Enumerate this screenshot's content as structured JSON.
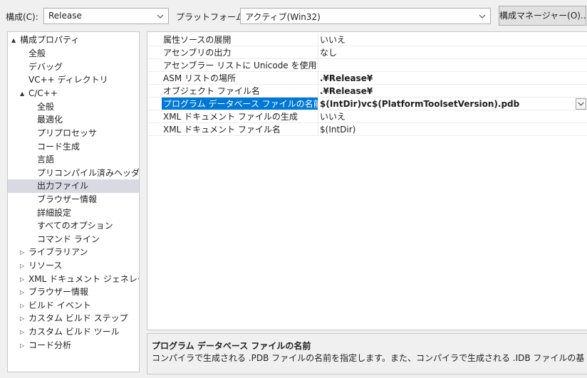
{
  "toolbar": {
    "config_label": "構成(C):",
    "config_value": "Release",
    "platform_label": "プラットフォーム(P):",
    "platform_value": "アクティブ(Win32)",
    "config_manager_label": "構成マネージャー(O)..."
  },
  "tree": {
    "items": [
      {
        "label": "構成プロパティ",
        "arrow": "▲"
      },
      {
        "label": "全般"
      },
      {
        "label": "デバッグ"
      },
      {
        "label": "VC++ ディレクトリ"
      },
      {
        "label": "C/C++",
        "arrow": "▲"
      },
      {
        "label": "全般"
      },
      {
        "label": "最適化"
      },
      {
        "label": "プリプロセッサ"
      },
      {
        "label": "コード生成"
      },
      {
        "label": "言語"
      },
      {
        "label": "プリコンパイル済みヘッダー"
      },
      {
        "label": "出力ファイル"
      },
      {
        "label": "ブラウザー情報"
      },
      {
        "label": "詳細設定"
      },
      {
        "label": "すべてのオプション"
      },
      {
        "label": "コマンド ライン"
      },
      {
        "label": "ライブラリアン",
        "arrow": "▷"
      },
      {
        "label": "リソース",
        "arrow": "▷"
      },
      {
        "label": "XML ドキュメント ジェネレーター",
        "arrow": "▷"
      },
      {
        "label": "ブラウザー情報",
        "arrow": "▷"
      },
      {
        "label": "ビルド イベント",
        "arrow": "▷"
      },
      {
        "label": "カスタム ビルド ステップ",
        "arrow": "▷"
      },
      {
        "label": "カスタム ビルド ツール",
        "arrow": "▷"
      },
      {
        "label": "コード分析",
        "arrow": "▷"
      }
    ]
  },
  "properties": {
    "rows": [
      {
        "name": "属性ソースの展開",
        "value": "いいえ"
      },
      {
        "name": "アセンブリの出力",
        "value": "なし"
      },
      {
        "name": "アセンブラー リストに Unicode を使用する",
        "value": ""
      },
      {
        "name": "ASM リストの場所",
        "value": ".¥Release¥"
      },
      {
        "name": "オブジェクト ファイル名",
        "value": ".¥Release¥"
      },
      {
        "name": "プログラム データベース ファイルの名前",
        "value": "$(IntDir)vc$(PlatformToolsetVersion).pdb"
      },
      {
        "name": "XML ドキュメント ファイルの生成",
        "value": "いいえ"
      },
      {
        "name": "XML ドキュメント ファイル名",
        "value": "$(IntDir)"
      }
    ]
  },
  "description": {
    "title": "プログラム データベース ファイルの名前",
    "text": "コンパイラで生成される .PDB ファイルの名前を指定します。また、コンパイラで生成される .IDB ファイルの基本名も指定します。ファ..."
  },
  "colors": {
    "selection_accent": "#0078d7",
    "tree_selection": "#d9d9e3"
  }
}
